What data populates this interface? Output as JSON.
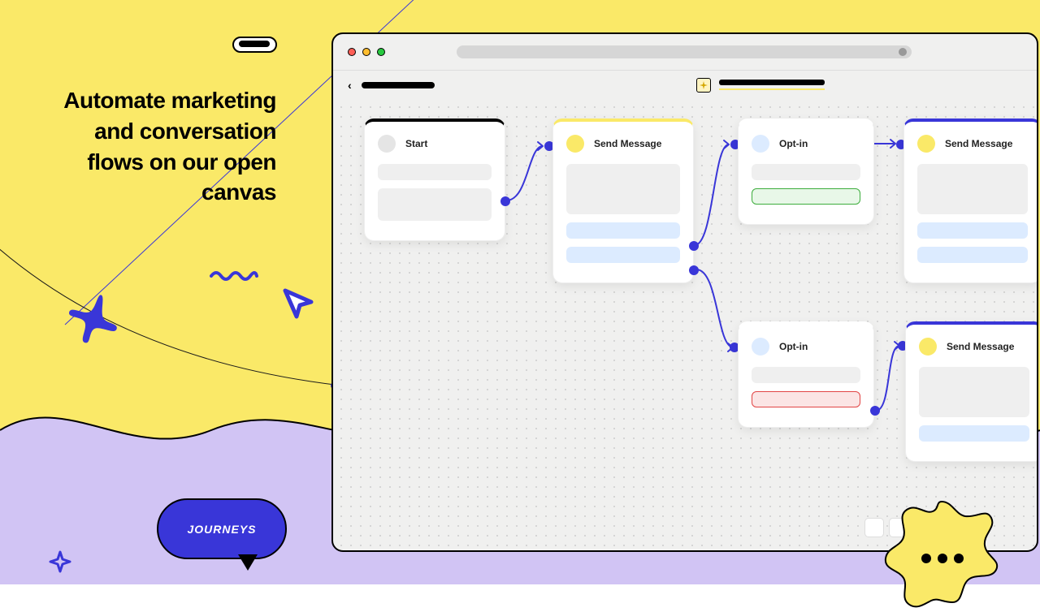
{
  "headline": "Automate marketing and conversation flows on our open canvas",
  "bubble_label": "JOURNEYS",
  "cards": {
    "c1": {
      "title": "Start"
    },
    "c2": {
      "title": "Send Message"
    },
    "c3": {
      "title": "Opt-in"
    },
    "c4": {
      "title": "Send Message"
    },
    "c5": {
      "title": "Opt-in"
    },
    "c6": {
      "title": "Send Message"
    }
  },
  "colors": {
    "yellow": "#FAE968",
    "purple": "#D1C4F4",
    "blue": "#3936D8"
  }
}
